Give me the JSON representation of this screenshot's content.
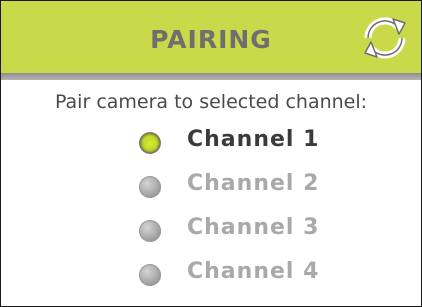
{
  "header": {
    "title": "PAIRING",
    "refresh_icon": "refresh-icon",
    "accent_color": "#c9d94a"
  },
  "main": {
    "instruction": "Pair camera to selected channel:",
    "selected_channel": 1,
    "channels": [
      {
        "label": "Channel 1",
        "selected": true
      },
      {
        "label": "Channel 2",
        "selected": false
      },
      {
        "label": "Channel 3",
        "selected": false
      },
      {
        "label": "Channel 4",
        "selected": false
      }
    ]
  }
}
